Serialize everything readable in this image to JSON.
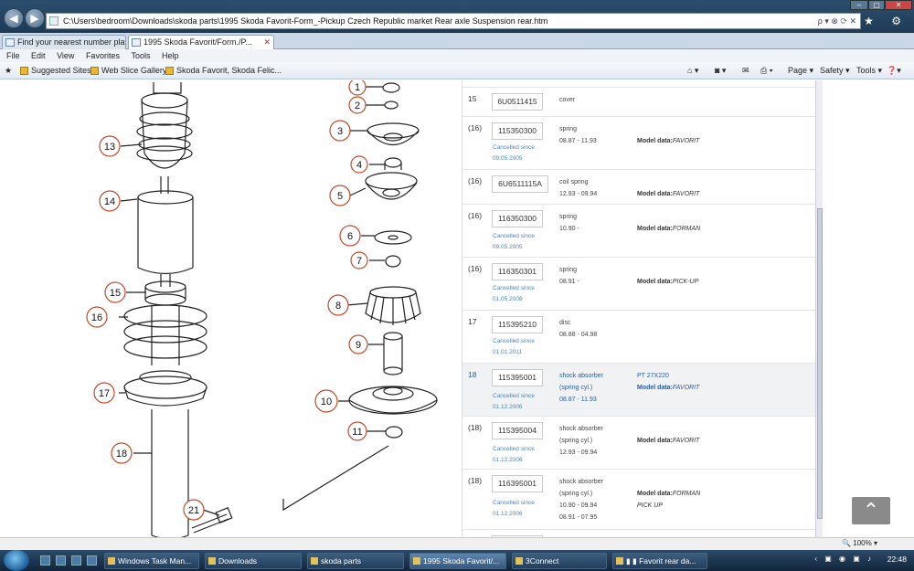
{
  "browser": {
    "address": "C:\\Users\\bedroom\\Downloads\\skoda parts\\1995 Skoda Favorit-Form_-Pickup Czech Republic market Rear axle Suspension rear.htm",
    "back_label": "◀",
    "forward_label": "▶",
    "addr_tools": "ρ ▾ ⊗ ⟳ ✕",
    "right_icons": "⌂ ★ ⚙",
    "tabs": [
      {
        "label": "Find your nearest number plat..."
      },
      {
        "label": "1995 Skoda Favorit/Form./P..."
      }
    ],
    "menu": [
      "File",
      "Edit",
      "View",
      "Favorites",
      "Tools",
      "Help"
    ],
    "favorites": [
      {
        "label": "Suggested Sites"
      },
      {
        "label": "Web Slice Gallery"
      },
      {
        "label": "Skoda Favorit, Skoda Felic..."
      }
    ],
    "toolbar_right": {
      "page": "Page ▾",
      "safety": "Safety ▾",
      "tools": "Tools ▾",
      "help": "❓▾"
    },
    "zoom": "100%"
  },
  "diagram": {
    "left_callouts": [
      "13",
      "14",
      "15",
      "16",
      "17",
      "18",
      "21"
    ],
    "right_callouts": [
      "1",
      "2",
      "3",
      "4",
      "5",
      "6",
      "7",
      "8",
      "9",
      "10",
      "11"
    ]
  },
  "parts": [
    {
      "pos": "15",
      "num": "6U0511415",
      "cancelled": "",
      "desc": "cover",
      "dates": "",
      "extra": "",
      "model": ""
    },
    {
      "pos": "(16)",
      "num": "115350300",
      "cancelled": "Cancelled since",
      "cdate": "09.05.2005",
      "desc": "spring",
      "dates": "08.87 - 11.93",
      "extra": "",
      "model_label": "Model data:",
      "model": "FAVORIT"
    },
    {
      "pos": "(16)",
      "num": "6U6511115A",
      "cancelled": "",
      "desc": "coil spring",
      "dates": "12.93 - 09.94",
      "extra": "",
      "model_label": "Model data:",
      "model": "FAVORIT"
    },
    {
      "pos": "(16)",
      "num": "116350300",
      "cancelled": "Cancelled since",
      "cdate": "09.05.2005",
      "desc": "spring",
      "dates": "10.90 -",
      "extra": "",
      "model_label": "Model data:",
      "model": "FORMAN"
    },
    {
      "pos": "(16)",
      "num": "116350301",
      "cancelled": "Cancelled since",
      "cdate": "01.05.2008",
      "desc": "spring",
      "dates": "08.91 -",
      "extra": "",
      "model_label": "Model data:",
      "model": "PICK-UP"
    },
    {
      "pos": "17",
      "num": "115395210",
      "cancelled": "Cancelled since",
      "cdate": "01.01.2011",
      "desc": "disc",
      "dates": "08.88 - 04.98",
      "extra": "",
      "model": ""
    },
    {
      "pos": "18",
      "num": "115395001",
      "cancelled": "Cancelled since",
      "cdate": "01.12.2006",
      "desc": "shock absorber",
      "desc2": "(spring cyl.)",
      "dates": "08.87 - 11.93",
      "extra": "PT 27X220",
      "model_label": "Model data:",
      "model": "FAVORIT"
    },
    {
      "pos": "(18)",
      "num": "115395004",
      "cancelled": "Cancelled since",
      "cdate": "01.12.2006",
      "desc": "shock absorber",
      "desc2": "(spring cyl.)",
      "dates": "12.93 - 09.94",
      "extra": "",
      "model_label": "Model data:",
      "model": "FAVORIT"
    },
    {
      "pos": "(18)",
      "num": "116395001",
      "cancelled": "Cancelled since",
      "cdate": "01.12.2006",
      "desc": "shock absorber",
      "desc2": "(spring cyl.)",
      "dates": "10.90 - 09.94",
      "dates2": "08.91 - 07.95",
      "extra": "",
      "model_label": "Model data:",
      "model": "FORMAN",
      "model2": "PICK UP"
    }
  ],
  "scroll_top_label": "⌃",
  "taskbar": {
    "items": [
      {
        "label": "Windows Task Man..."
      },
      {
        "label": "Downloads"
      },
      {
        "label": "skoda parts"
      },
      {
        "label": "1995 Skoda Favorit/..."
      },
      {
        "label": "3Connect"
      },
      {
        "label": "▮ ▮ Favorit rear da..."
      }
    ],
    "tray": "‹ ▣ ◉ ▣ ♪",
    "clock": "22:48"
  }
}
